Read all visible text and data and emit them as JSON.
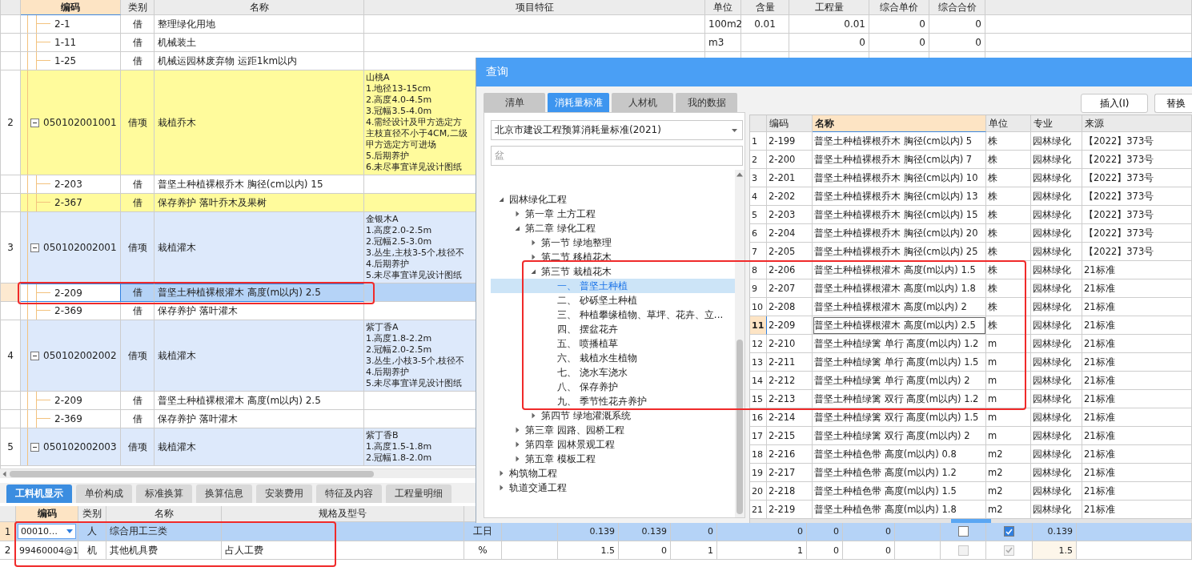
{
  "main_table": {
    "columns": [
      {
        "label": "编码",
        "selected": true
      },
      {
        "label": "类别",
        "selected": false
      },
      {
        "label": "名称",
        "selected": false
      },
      {
        "label": "项目特征",
        "selected": false
      },
      {
        "label": "单位",
        "selected": false
      },
      {
        "label": "含量",
        "selected": false
      },
      {
        "label": "工程量",
        "selected": false
      },
      {
        "label": "综合单价",
        "selected": false
      },
      {
        "label": "综合合价",
        "selected": false
      }
    ],
    "rows": [
      {
        "kind": "item",
        "code": "2-1",
        "category": "借",
        "name": "整理绿化用地",
        "unit": "100m2",
        "content": "0.01",
        "quantity": "0.01",
        "unit_price": "0",
        "total_price": "0",
        "color": "#ffffff",
        "selected": false
      },
      {
        "kind": "item",
        "code": "1-11",
        "category": "借",
        "name": "机械装土",
        "unit": "m3",
        "quantity": "0",
        "unit_price": "0",
        "total_price": "0",
        "color": "#ffffff",
        "selected": false
      },
      {
        "kind": "item",
        "code": "1-25",
        "category": "借",
        "name": "机械运园林废弃物 运距1km以内",
        "color": "#ffffff",
        "selected": false
      },
      {
        "kind": "group",
        "number": "2",
        "code": "050102001001",
        "category": "借项",
        "name": "栽植乔木",
        "expanded": true,
        "features": [
          "山桃A",
          "1.地径13-15cm",
          "2.高度4.0-4.5m",
          "3.冠幅3.5-4.0m",
          "4.需经设计及甲方选定方",
          "主枝直径不小于4CM,二级",
          "甲方选定方可进场",
          "5.后期养护",
          "6.未尽事宜详见设计图纸"
        ],
        "color": "#fffb9c",
        "selected": false
      },
      {
        "kind": "item",
        "code": "2-203",
        "category": "借",
        "name": "普坚土种植裸根乔木 胸径(cm以内) 15",
        "color": "#ffffff",
        "selected": false
      },
      {
        "kind": "item",
        "code": "2-367",
        "category": "借",
        "name": "保存养护 落叶乔木及果树",
        "color": "#fffb9c",
        "selected": false
      },
      {
        "kind": "group",
        "number": "3",
        "code": "050102002001",
        "category": "借项",
        "name": "栽植灌木",
        "expanded": true,
        "features": [
          "金银木A",
          "1.高度2.0-2.5m",
          "2.冠幅2.5-3.0m",
          "3.丛生,主枝3-5个,枝径不",
          "4.后期养护",
          "5.未尽事宜详见设计图纸"
        ],
        "color": "#dde9fb",
        "selected": false
      },
      {
        "kind": "item",
        "code": "2-209",
        "category": "借",
        "name": "普坚土种植裸根灌木 高度(m以内) 2.5",
        "selected": true
      },
      {
        "kind": "item",
        "code": "2-369",
        "category": "借",
        "name": "保存养护 落叶灌木",
        "color": "#ffffff",
        "selected": false
      },
      {
        "kind": "group",
        "number": "4",
        "code": "050102002002",
        "category": "借项",
        "name": "栽植灌木",
        "expanded": true,
        "features": [
          "紫丁香A",
          "1.高度1.8-2.2m",
          "2.冠幅2.0-2.5m",
          "3.丛生,小枝3-5个,枝径不",
          "4.后期养护",
          "5.未尽事宜详见设计图纸"
        ],
        "color": "#dde9fb",
        "selected": false
      },
      {
        "kind": "item",
        "code": "2-209",
        "category": "借",
        "name": "普坚土种植裸根灌木 高度(m以内) 2.5",
        "color": "#ffffff",
        "selected": false
      },
      {
        "kind": "item",
        "code": "2-369",
        "category": "借",
        "name": "保存养护 落叶灌木",
        "color": "#ffffff",
        "selected": false
      },
      {
        "kind": "group",
        "number": "5",
        "code": "050102002003",
        "category": "借项",
        "name": "栽植灌木",
        "expanded": true,
        "features": [
          "紫丁香B",
          "1.高度1.5-1.8m",
          "2.冠幅1.8-2.0m"
        ],
        "color": "#dde9fb",
        "selected": false
      }
    ]
  },
  "bottom_panel": {
    "tabs": [
      {
        "label": "工料机显示",
        "selected": true
      },
      {
        "label": "单价构成",
        "selected": false
      },
      {
        "label": "标准换算",
        "selected": false
      },
      {
        "label": "换算信息",
        "selected": false
      },
      {
        "label": "安装费用",
        "selected": false
      },
      {
        "label": "特征及内容",
        "selected": false
      },
      {
        "label": "工程量明细",
        "selected": false
      }
    ],
    "columns": [
      {
        "label": "编码",
        "selected": true
      },
      {
        "label": "类别",
        "selected": false
      },
      {
        "label": "名称",
        "selected": false
      },
      {
        "label": "规格及型号",
        "selected": false
      }
    ],
    "rows": [
      {
        "number": "1",
        "code": "00010…",
        "editing": true,
        "category": "人",
        "name": "综合用工三类",
        "unit": "工日",
        "values": [
          "0.139",
          "0.139",
          "0",
          "0",
          "0",
          "0"
        ],
        "checks": [
          {
            "checked": false,
            "disabled": false
          },
          {
            "checked": true,
            "disabled": false
          }
        ],
        "amount": "0.139",
        "selected": true
      },
      {
        "number": "2",
        "code": "99460004@1",
        "editing": false,
        "category": "机",
        "name": "其他机具费",
        "spec": "占人工费",
        "unit": "%",
        "values": [
          "1.5",
          "0",
          "1",
          "1",
          "0",
          "0"
        ],
        "checks": [
          {
            "checked": false,
            "disabled": true
          },
          {
            "checked": true,
            "disabled": true
          }
        ],
        "amount": "1.5",
        "selected": false
      }
    ]
  },
  "dialog": {
    "title": "查询",
    "tabs": [
      {
        "label": "清单",
        "selected": false
      },
      {
        "label": "消耗量标准",
        "selected": true
      },
      {
        "label": "人材机",
        "selected": false
      },
      {
        "label": "我的数据",
        "selected": false
      }
    ],
    "library": "北京市建设工程预算消耗量标准(2021)",
    "search": {
      "value": "盆"
    },
    "tree": [
      {
        "label": "园林绿化工程",
        "kind": "branch",
        "expanded": true,
        "selected": false,
        "children": [
          {
            "label": "第一章 土方工程",
            "kind": "branch",
            "expanded": false,
            "selected": false
          },
          {
            "label": "第二章 绿化工程",
            "kind": "branch",
            "expanded": true,
            "selected": false,
            "children": [
              {
                "label": "第一节 绿地整理",
                "kind": "branch",
                "expanded": false,
                "selected": false
              },
              {
                "label": "第二节 移植花木",
                "kind": "branch",
                "expanded": false,
                "selected": false
              },
              {
                "label": "第三节 栽植花木",
                "kind": "branch",
                "expanded": true,
                "selected": false,
                "children": [
                  {
                    "label": "一、 普坚土种植",
                    "kind": "leaf",
                    "selected": true
                  },
                  {
                    "label": "二、 砂砾坚土种植",
                    "kind": "leaf",
                    "selected": false
                  },
                  {
                    "label": "三、 种植攀缘植物、草坪、花卉、立...",
                    "kind": "leaf",
                    "selected": false
                  },
                  {
                    "label": "四、 摆盆花卉",
                    "kind": "leaf",
                    "selected": false
                  },
                  {
                    "label": "五、 喷播植草",
                    "kind": "leaf",
                    "selected": false
                  },
                  {
                    "label": "六、 栽植水生植物",
                    "kind": "leaf",
                    "selected": false
                  },
                  {
                    "label": "七、 浇水车浇水",
                    "kind": "leaf",
                    "selected": false
                  },
                  {
                    "label": "八、 保存养护",
                    "kind": "leaf",
                    "selected": false
                  },
                  {
                    "label": "九、 季节性花卉养护",
                    "kind": "leaf",
                    "selected": false
                  }
                ]
              },
              {
                "label": "第四节 绿地灌溉系统",
                "kind": "branch",
                "expanded": false,
                "selected": false
              }
            ]
          },
          {
            "label": "第三章 园路、园桥工程",
            "kind": "branch",
            "expanded": false,
            "selected": false
          },
          {
            "label": "第四章 园林景观工程",
            "kind": "branch",
            "expanded": false,
            "selected": false
          },
          {
            "label": "第五章 模板工程",
            "kind": "branch",
            "expanded": false,
            "selected": false
          }
        ]
      },
      {
        "label": "构筑物工程",
        "kind": "branch",
        "expanded": false,
        "selected": false
      },
      {
        "label": "轨道交通工程",
        "kind": "branch",
        "expanded": false,
        "selected": false
      }
    ],
    "buttons": [
      "插入(I)",
      "替换"
    ],
    "table": {
      "columns": [
        {
          "label": "编码",
          "selected": false
        },
        {
          "label": "名称",
          "selected": true
        },
        {
          "label": "单位",
          "selected": false
        },
        {
          "label": "专业",
          "selected": false
        },
        {
          "label": "来源",
          "selected": false
        }
      ],
      "rows": [
        {
          "number": "1",
          "code": "2-199",
          "name": "普坚土种植裸根乔木 胸径(cm以内) 5",
          "unit": "株",
          "major": "园林绿化",
          "source": "【2022】373号",
          "selected": false
        },
        {
          "number": "2",
          "code": "2-200",
          "name": "普坚土种植裸根乔木 胸径(cm以内) 7",
          "unit": "株",
          "major": "园林绿化",
          "source": "【2022】373号",
          "selected": false
        },
        {
          "number": "3",
          "code": "2-201",
          "name": "普坚土种植裸根乔木 胸径(cm以内) 10",
          "unit": "株",
          "major": "园林绿化",
          "source": "【2022】373号",
          "selected": false
        },
        {
          "number": "4",
          "code": "2-202",
          "name": "普坚土种植裸根乔木 胸径(cm以内) 13",
          "unit": "株",
          "major": "园林绿化",
          "source": "【2022】373号",
          "selected": false
        },
        {
          "number": "5",
          "code": "2-203",
          "name": "普坚土种植裸根乔木 胸径(cm以内) 15",
          "unit": "株",
          "major": "园林绿化",
          "source": "【2022】373号",
          "selected": false
        },
        {
          "number": "6",
          "code": "2-204",
          "name": "普坚土种植裸根乔木 胸径(cm以内) 20",
          "unit": "株",
          "major": "园林绿化",
          "source": "【2022】373号",
          "selected": false
        },
        {
          "number": "7",
          "code": "2-205",
          "name": "普坚土种植裸根乔木 胸径(cm以内) 25",
          "unit": "株",
          "major": "园林绿化",
          "source": "【2022】373号",
          "selected": false
        },
        {
          "number": "8",
          "code": "2-206",
          "name": "普坚土种植裸根灌木 高度(m以内) 1.5",
          "unit": "株",
          "major": "园林绿化",
          "source": "21标准",
          "selected": false
        },
        {
          "number": "9",
          "code": "2-207",
          "name": "普坚土种植裸根灌木 高度(m以内) 1.8",
          "unit": "株",
          "major": "园林绿化",
          "source": "21标准",
          "selected": false
        },
        {
          "number": "10",
          "code": "2-208",
          "name": "普坚土种植裸根灌木 高度(m以内) 2",
          "unit": "株",
          "major": "园林绿化",
          "source": "21标准",
          "selected": false
        },
        {
          "number": "11",
          "code": "2-209",
          "name": "普坚土种植裸根灌木 高度(m以内) 2.5",
          "unit": "株",
          "major": "园林绿化",
          "source": "21标准",
          "selected": true
        },
        {
          "number": "12",
          "code": "2-210",
          "name": "普坚土种植绿篱 单行 高度(m以内) 1.2",
          "unit": "m",
          "major": "园林绿化",
          "source": "21标准",
          "selected": false
        },
        {
          "number": "13",
          "code": "2-211",
          "name": "普坚土种植绿篱 单行 高度(m以内) 1.5",
          "unit": "m",
          "major": "园林绿化",
          "source": "21标准",
          "selected": false
        },
        {
          "number": "14",
          "code": "2-212",
          "name": "普坚土种植绿篱 单行 高度(m以内) 2",
          "unit": "m",
          "major": "园林绿化",
          "source": "21标准",
          "selected": false
        },
        {
          "number": "15",
          "code": "2-213",
          "name": "普坚土种植绿篱 双行 高度(m以内) 1.2",
          "unit": "m",
          "major": "园林绿化",
          "source": "21标准",
          "selected": false
        },
        {
          "number": "16",
          "code": "2-214",
          "name": "普坚土种植绿篱 双行 高度(m以内) 1.5",
          "unit": "m",
          "major": "园林绿化",
          "source": "21标准",
          "selected": false
        },
        {
          "number": "17",
          "code": "2-215",
          "name": "普坚土种植绿篱 双行 高度(m以内) 2",
          "unit": "m",
          "major": "园林绿化",
          "source": "21标准",
          "selected": false
        },
        {
          "number": "18",
          "code": "2-216",
          "name": "普坚土种植色带 高度(m以内) 0.8",
          "unit": "m2",
          "major": "园林绿化",
          "source": "21标准",
          "selected": false
        },
        {
          "number": "19",
          "code": "2-217",
          "name": "普坚土种植色带 高度(m以内) 1.2",
          "unit": "m2",
          "major": "园林绿化",
          "source": "21标准",
          "selected": false
        },
        {
          "number": "20",
          "code": "2-218",
          "name": "普坚土种植色带 高度(m以内) 1.5",
          "unit": "m2",
          "major": "园林绿化",
          "source": "21标准",
          "selected": false
        },
        {
          "number": "21",
          "code": "2-219",
          "name": "普坚土种植色带 高度(m以内) 1.8",
          "unit": "m2",
          "major": "园林绿化",
          "source": "21标准",
          "selected": false
        }
      ]
    }
  }
}
